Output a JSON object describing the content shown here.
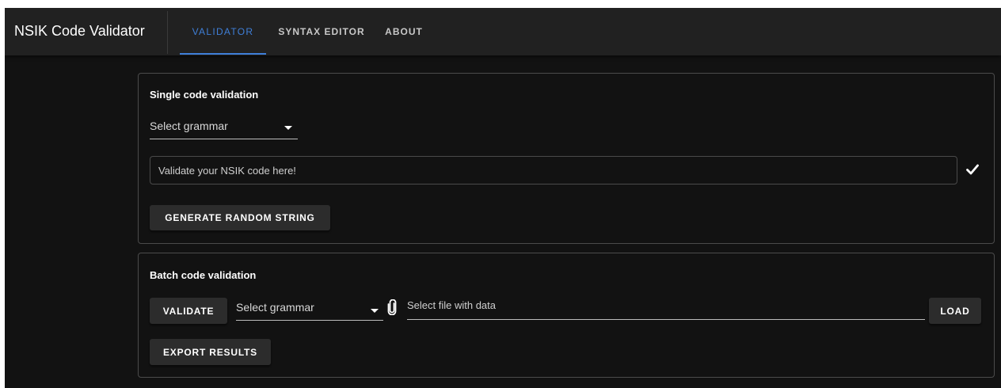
{
  "header": {
    "app_title": "NSIK Code Validator",
    "tabs": [
      {
        "label": "VALIDATOR",
        "active": true
      },
      {
        "label": "SYNTAX EDITOR",
        "active": false
      },
      {
        "label": "ABOUT",
        "active": false
      }
    ]
  },
  "single": {
    "title": "Single code validation",
    "grammar_select": "Select grammar",
    "code_placeholder": "Validate your NSIK code here!",
    "generate_button": "GENERATE RANDOM STRING",
    "validate_icon": "check-icon"
  },
  "batch": {
    "title": "Batch code validation",
    "validate_button": "VALIDATE",
    "grammar_select": "Select grammar",
    "file_placeholder": "Select file with data",
    "file_icon": "paperclip-icon",
    "load_button": "LOAD",
    "export_button": "EXPORT RESULTS"
  },
  "colors": {
    "accent": "#3f7fd8",
    "background": "#121212",
    "appbar": "#212121",
    "button": "#2c2c2c"
  }
}
